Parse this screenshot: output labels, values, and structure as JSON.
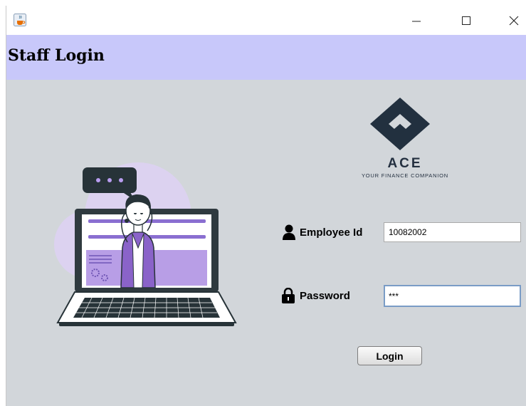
{
  "window": {
    "app_icon": "java-cup-icon",
    "controls": {
      "minimize": "minimize-icon",
      "maximize": "maximize-icon",
      "close": "close-icon"
    }
  },
  "header": {
    "title": "Staff Login",
    "background": "#c8c8fa"
  },
  "brand": {
    "name": "ACE",
    "tagline": "YOUR FINANCE COMPANION",
    "color": "#243040"
  },
  "illustration": {
    "subject": "support-agent-on-laptop",
    "accent": "#9b7fd9"
  },
  "form": {
    "employee_id": {
      "icon": "user-icon",
      "label": "Employee Id",
      "value": "10082002"
    },
    "password": {
      "icon": "lock-icon",
      "label": "Password",
      "value": "***"
    },
    "submit_label": "Login"
  }
}
